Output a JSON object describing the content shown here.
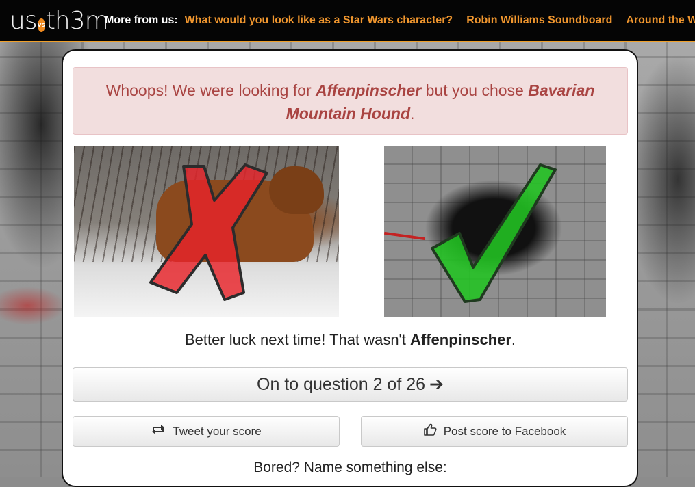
{
  "header": {
    "logo_text_left": "us",
    "logo_vs": "vs",
    "logo_text_right": "th3m",
    "more_label": "More from us:",
    "links": [
      "What would you look like as a Star Wars character?",
      "Robin Williams Soundboard",
      "Around the World in 80"
    ]
  },
  "alert": {
    "prefix": "Whoops! We were looking for",
    "correct": "Affenpinscher",
    "middle": "but you chose",
    "chosen": "Bavarian Mountain Hound",
    "suffix": "."
  },
  "images": {
    "left_mark": "wrong-x",
    "right_mark": "correct-check"
  },
  "caption": {
    "prefix": "Better luck next time! That wasn't",
    "breed": "Affenpinscher",
    "suffix": "."
  },
  "buttons": {
    "next_label": "On to question 2 of 26",
    "next_icon": "➔",
    "tweet_label": "Tweet your score",
    "tweet_icon": "⟲",
    "facebook_label": "Post score to Facebook",
    "facebook_icon": "👍"
  },
  "footer": {
    "bored_text": "Bored? Name something else:"
  },
  "colors": {
    "accent_orange": "#f0962e",
    "alert_text": "#a94442",
    "alert_bg": "#f2dede",
    "wrong_red": "#e8232a",
    "correct_green": "#22c422"
  }
}
